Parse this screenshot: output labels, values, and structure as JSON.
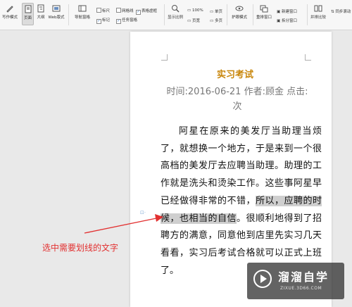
{
  "ribbon": {
    "writing_mode": "写作模式",
    "page_view": "页面",
    "outline": "大纲",
    "web_view": "Web版式",
    "nav_pane": "导航窗格",
    "ruler": "标尺",
    "gridlines": "网格线",
    "table_gridlines": "表格虚框",
    "markup": "标记",
    "task_pane": "任务窗格",
    "zoom": "显示比例",
    "zoom_100": "100%",
    "single_page": "单页",
    "page_width": "页宽",
    "multi_page": "多页",
    "step_record": "护眼模式",
    "reset_window": "重排窗口",
    "new_window": "新建窗口",
    "split_window": "拆分窗口",
    "side_by_side": "并排比较",
    "sync_scroll": "同步滚动"
  },
  "document": {
    "title": "实习考试",
    "meta": "时间:2016-06-21 作者:顾金 点击:次",
    "body_before": "阿星在原来的美发厅当助理当烦了，就想换一个地方，于是来到一个很高档的美发厅去应聘当助理。助理的工作就是洗头和烫染工作。这些事阿星早已经做得非常的不错，",
    "body_highlight": "所以，应聘的时候，也相当的自信",
    "body_after": "。很顺利地得到了招聘方的满意，同意他到店里先实习几天看看，实习后考试合格就可以正式上班了。"
  },
  "annotation": {
    "text": "选中需要划线的文字"
  },
  "watermark": {
    "brand": "溜溜自学",
    "url": "ZIXUE.3D66.COM"
  },
  "colors": {
    "title": "#c8860a",
    "annotation": "#e23030",
    "highlight": "#cfcfcf"
  }
}
